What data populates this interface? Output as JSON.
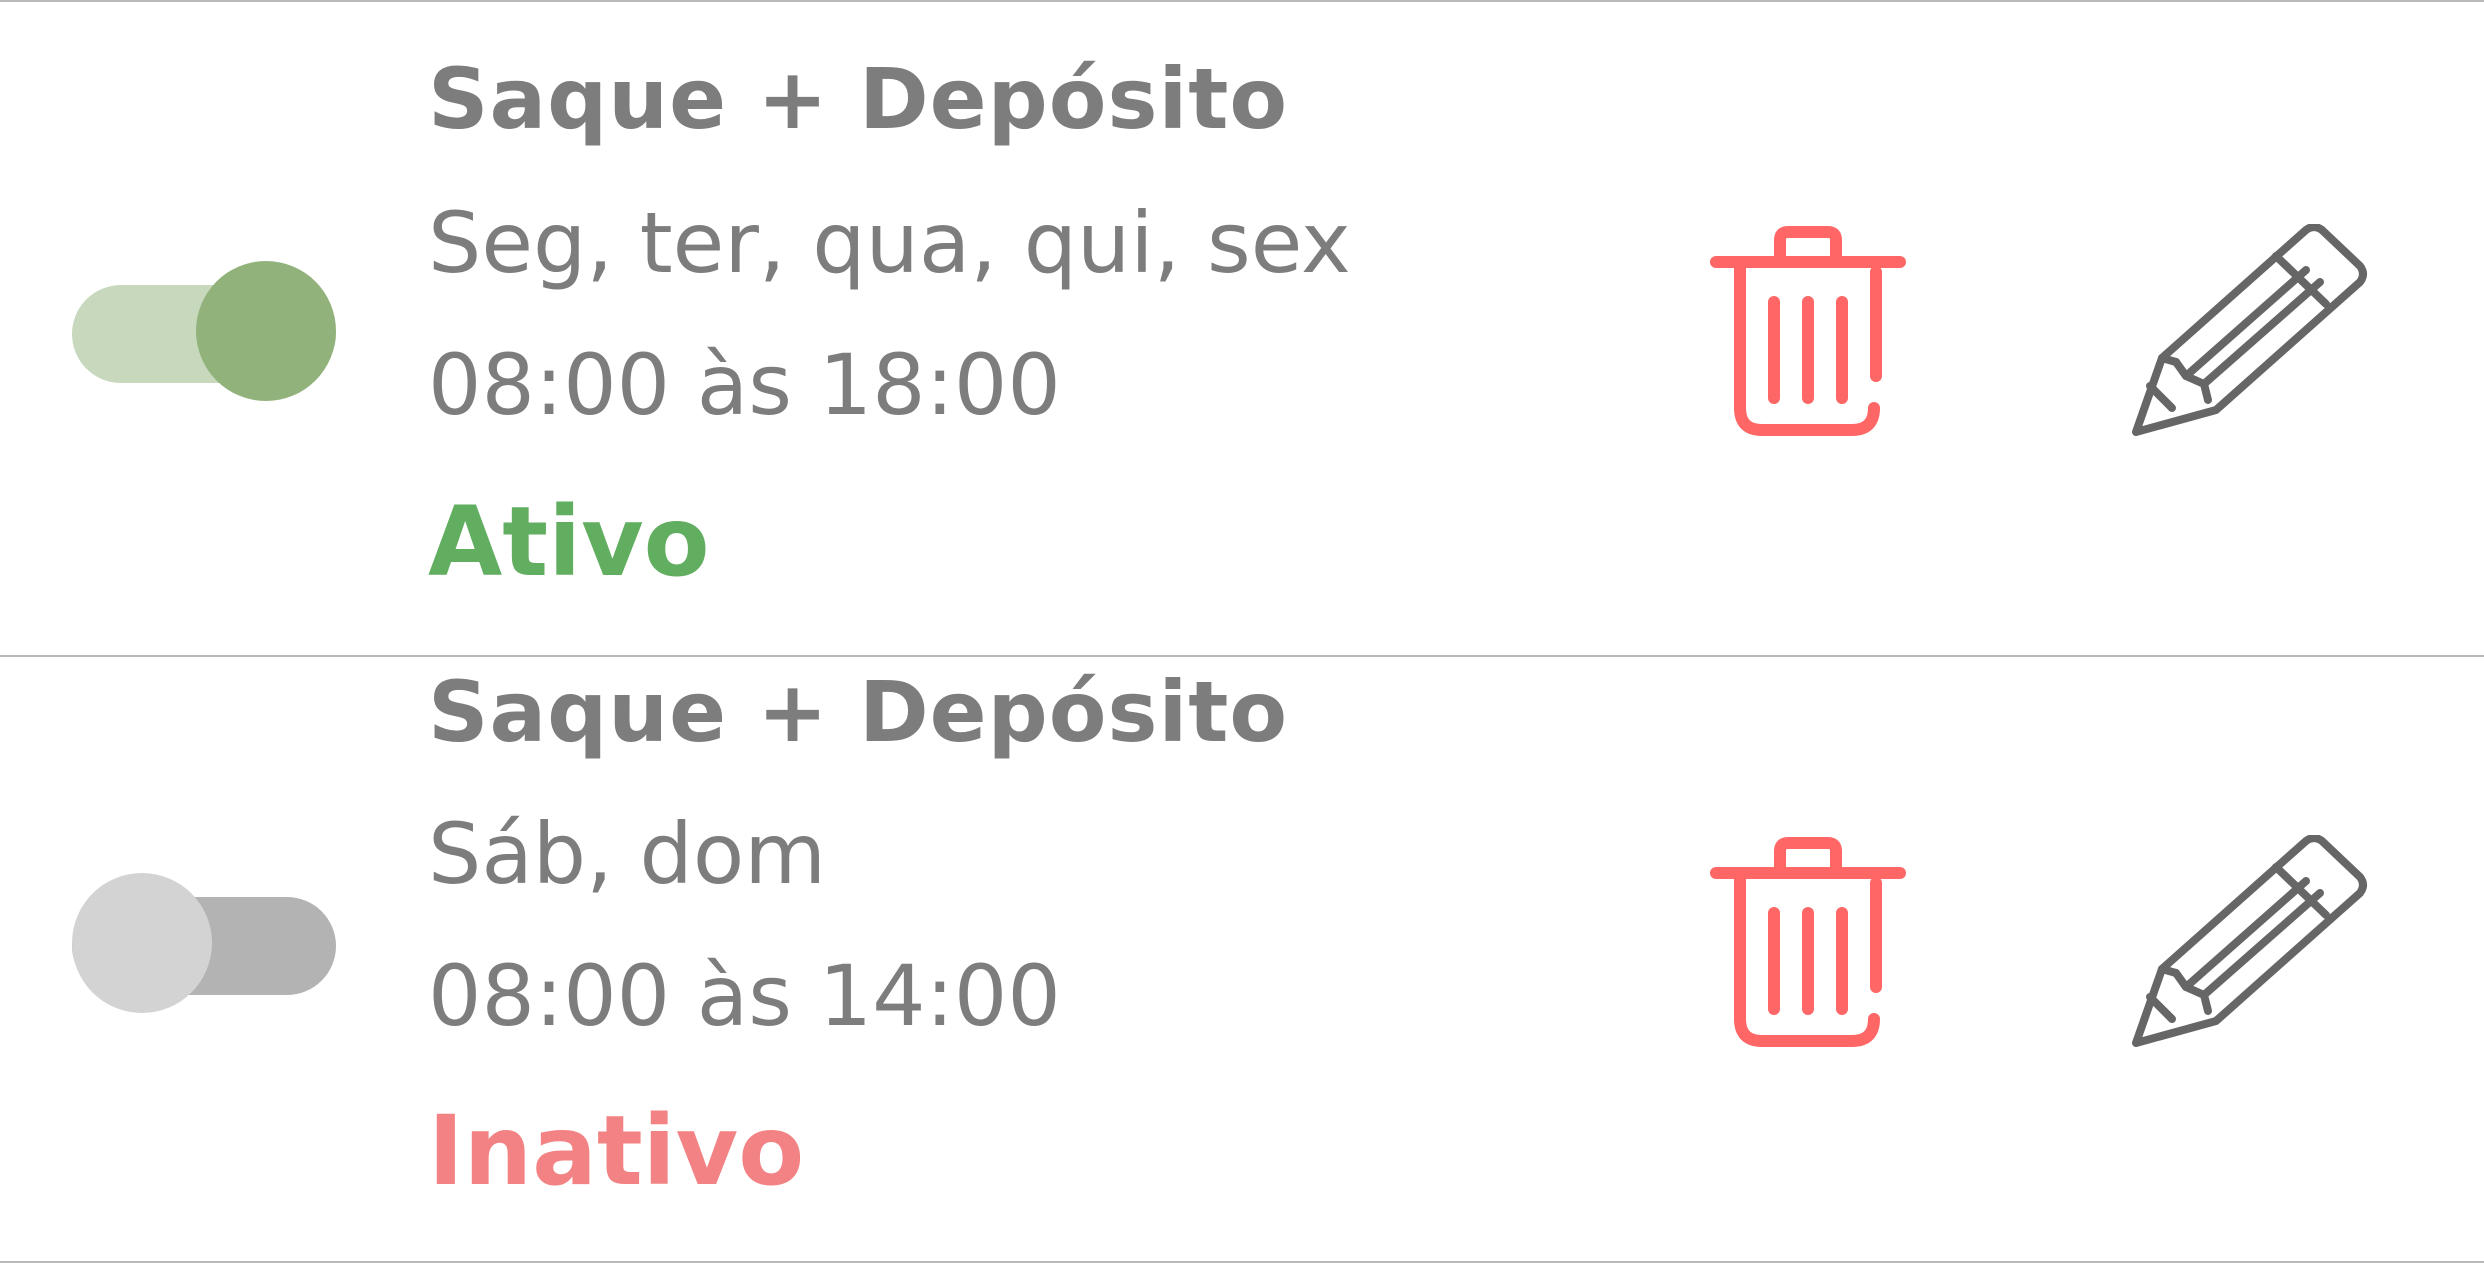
{
  "schedules": [
    {
      "title": "Saque + Depósito",
      "days": "Seg, ter, qua, qui, sex",
      "hours": "08:00 às 18:00",
      "status": "Ativo",
      "enabled": true
    },
    {
      "title": "Saque + Depósito",
      "days": "Sáb, dom",
      "hours": "08:00 às 14:00",
      "status": "Inativo",
      "enabled": false
    }
  ],
  "icons": {
    "delete": "trash-icon",
    "edit": "pencil-icon"
  },
  "colors": {
    "active_status": "#62ae61",
    "inactive_status": "#f28283",
    "delete_icon": "#ff6666",
    "edit_icon": "#666666",
    "toggle_on_track": "#c7d8bd",
    "toggle_on_knob": "#92b27b",
    "toggle_off_track": "#b3b3b3",
    "toggle_off_knob": "#d3d3d3",
    "text": "#7d7d7d"
  }
}
